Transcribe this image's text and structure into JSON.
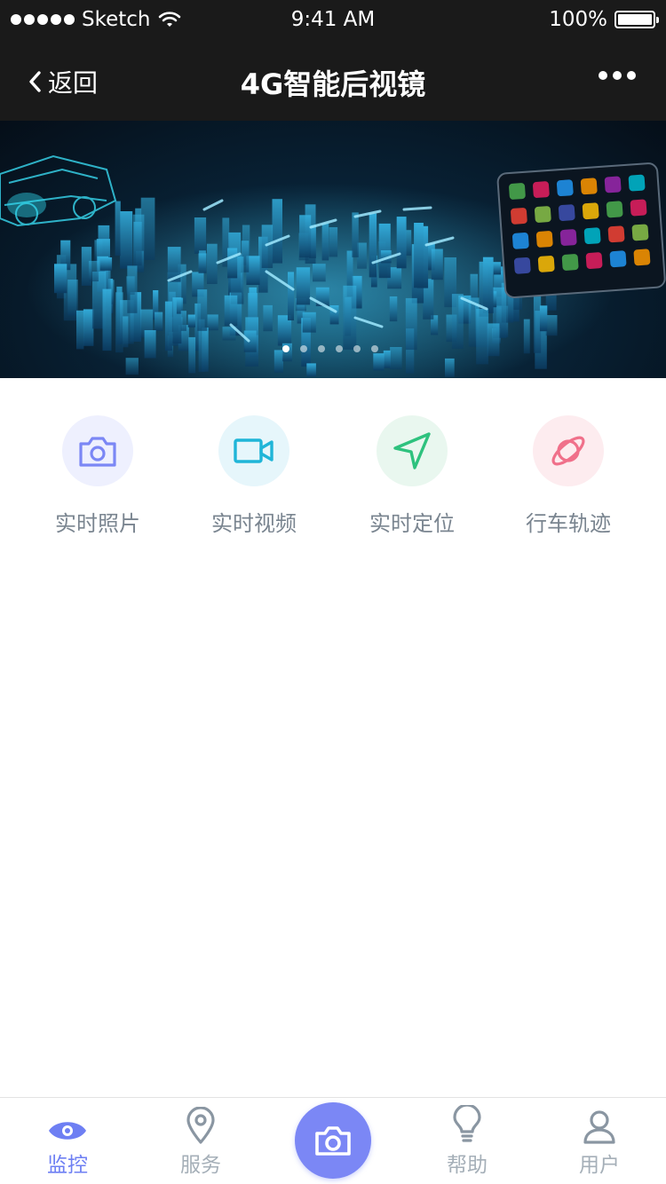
{
  "status_bar": {
    "carrier": "Sketch",
    "time": "9:41 AM",
    "battery": "100%"
  },
  "nav": {
    "back_label": "返回",
    "title": "4G智能后视镜"
  },
  "banner": {
    "page_count": 6,
    "active_index": 0
  },
  "menu": {
    "items": [
      {
        "label": "实时照片",
        "icon": "camera-icon",
        "color": "#7b87f5",
        "bg": "#eef0fe"
      },
      {
        "label": "实时视频",
        "icon": "video-icon",
        "color": "#1fb5d8",
        "bg": "#e6f6fb"
      },
      {
        "label": "实时定位",
        "icon": "navigation-icon",
        "color": "#2ec27e",
        "bg": "#e9f7ef"
      },
      {
        "label": "行车轨迹",
        "icon": "planet-icon",
        "color": "#f0708a",
        "bg": "#fdecef"
      }
    ]
  },
  "tabbar": {
    "items": [
      {
        "label": "监控",
        "icon": "eye-icon",
        "active": true
      },
      {
        "label": "服务",
        "icon": "location-pin-icon",
        "active": false
      },
      {
        "label": "帮助",
        "icon": "lightbulb-icon",
        "active": false
      },
      {
        "label": "用户",
        "icon": "user-icon",
        "active": false
      }
    ],
    "center_icon": "camera-icon"
  },
  "colors": {
    "accent": "#6e7ff3",
    "inactive": "#a5afb8",
    "header_bg": "#1a1a1a"
  }
}
